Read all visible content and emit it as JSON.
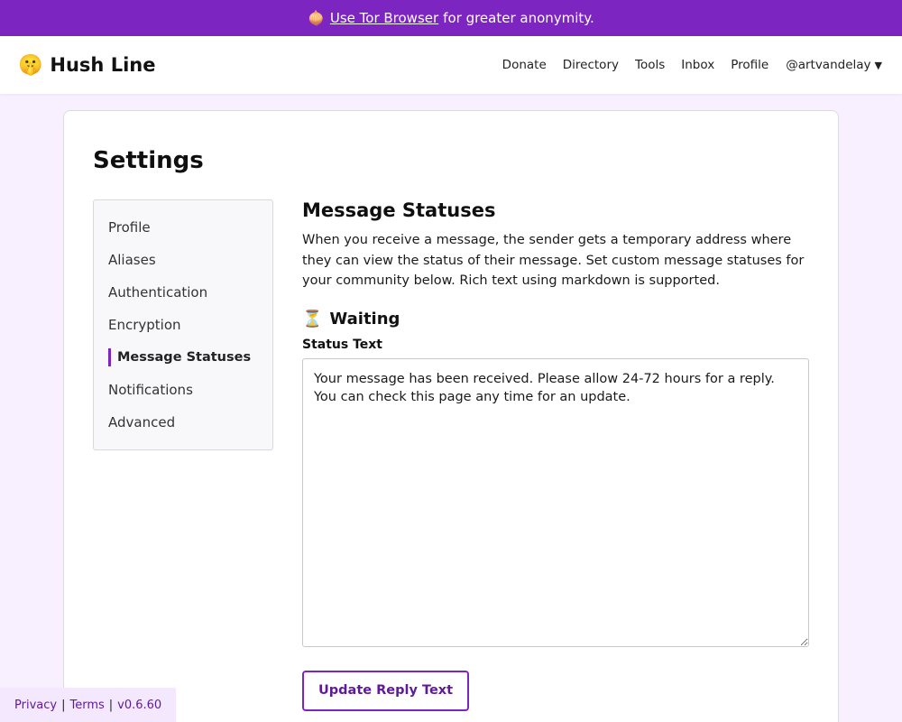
{
  "banner": {
    "link_text": "Use Tor Browser",
    "suffix": "for greater anonymity.",
    "icon": "onion-icon"
  },
  "brand": {
    "icon": "shushing-face-icon",
    "name": "Hush Line"
  },
  "nav": {
    "links": [
      "Donate",
      "Directory",
      "Tools",
      "Inbox",
      "Profile"
    ],
    "username": "@artvandelay"
  },
  "page": {
    "title": "Settings"
  },
  "settings_menu": {
    "items": [
      "Profile",
      "Aliases",
      "Authentication",
      "Encryption",
      "Message Statuses",
      "Notifications",
      "Advanced"
    ],
    "active": "Message Statuses"
  },
  "main": {
    "section_title": "Message Statuses",
    "description": "When you receive a message, the sender gets a temporary address where they can view the status of their message. Set custom message statuses for your community below. Rich text using markdown is supported.",
    "status_name": "Waiting",
    "status_icon": "hourglass-icon",
    "field_label": "Status Text",
    "status_text": "Your message has been received. Please allow 24-72 hours for a reply. You can check this page any time for an update.",
    "button_label": "Update Reply Text"
  },
  "footer": {
    "privacy": "Privacy",
    "terms": "Terms",
    "version": "v0.6.60"
  },
  "colors": {
    "accent": "#7d25c1",
    "page_background": "#f8f0ff"
  }
}
